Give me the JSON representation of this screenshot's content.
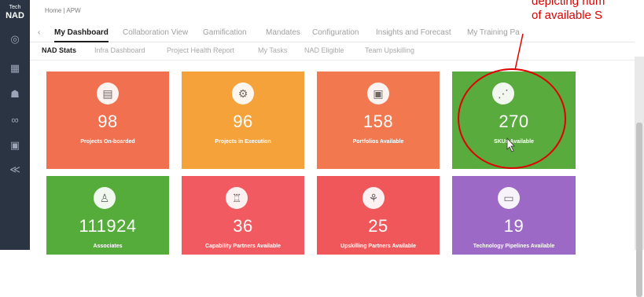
{
  "brand": {
    "small": "Tech",
    "big": "NAD"
  },
  "breadcrumb": "Home | APW",
  "main_tabs": [
    {
      "label": "My Dashboard",
      "active": true
    },
    {
      "label": "Collaboration View",
      "active": false
    },
    {
      "label": "Gamification",
      "active": false
    },
    {
      "label": "Mandates",
      "active": false
    },
    {
      "label": "Configuration",
      "active": false
    },
    {
      "label": "Insights and Forecast",
      "active": false
    },
    {
      "label": "My Training Pa",
      "active": false
    }
  ],
  "sub_tabs": [
    {
      "label": "NAD Stats",
      "active": true
    },
    {
      "label": "Infra Dashboard",
      "active": false
    },
    {
      "label": "Project Health Report",
      "active": false
    },
    {
      "label": "My Tasks",
      "active": false
    },
    {
      "label": "NAD Eligible",
      "active": false
    },
    {
      "label": "Team Upskilling",
      "active": false
    }
  ],
  "cards": [
    {
      "value": "98",
      "label": "Projects On-boarded",
      "color": "#f0704f",
      "icon": "presentation-board-icon"
    },
    {
      "value": "96",
      "label": "Projects in Execution",
      "color": "#f5a23a",
      "icon": "cycle-gear-icon"
    },
    {
      "value": "158",
      "label": "Portfolios Available",
      "color": "#f2784f",
      "icon": "easel-chart-icon"
    },
    {
      "value": "270",
      "label": "SKUs Available",
      "color": "#5aab3e",
      "icon": "network-nodes-icon"
    },
    {
      "value": "111924",
      "label": "Associates",
      "color": "#56ac3b",
      "icon": "user-outline-icon"
    },
    {
      "value": "36",
      "label": "Capability Partners Available",
      "color": "#f15a60",
      "icon": "org-group-icon"
    },
    {
      "value": "25",
      "label": "Upskilling Partners Available",
      "color": "#f0575a",
      "icon": "hierarchy-icon"
    },
    {
      "value": "19",
      "label": "Technology Pipelines Available",
      "color": "#9c6ac6",
      "icon": "monitor-screen-icon"
    }
  ],
  "annotation": {
    "line1": "depicting num",
    "line2": "of available S",
    "color": "#e10000"
  }
}
